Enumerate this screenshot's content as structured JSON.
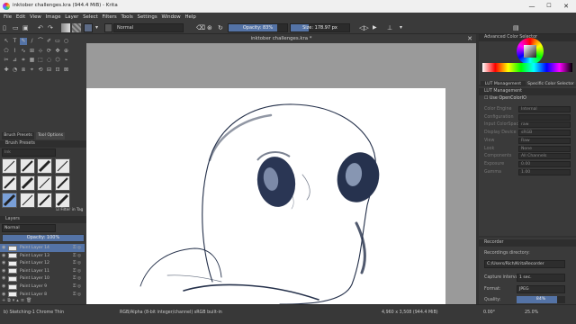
{
  "window": {
    "title": "inktober challenges.kra (944.4 MiB) - Krita",
    "minimize": "—",
    "maximize": "☐",
    "close": "✕"
  },
  "menu": [
    "File",
    "Edit",
    "View",
    "Image",
    "Layer",
    "Select",
    "Filters",
    "Tools",
    "Settings",
    "Window",
    "Help"
  ],
  "toolbar": {
    "blend_mode": "Normal",
    "opacity_label": "Opacity: 83%",
    "opacity_value": 0.83,
    "size_label": "Size: 178.97 px",
    "size_fill": 0.3
  },
  "document": {
    "tab_title": "inktober challenges.kra *"
  },
  "brush_panel": {
    "tab_presets": "Brush Presets",
    "tab_tool_options": "Tool Options",
    "header": "Brush Presets",
    "tag": "Ink",
    "filter_label": "Filter in Tag"
  },
  "layers_panel": {
    "header": "Layers",
    "blend_mode": "Normal",
    "opacity_label": "Opacity: 100%",
    "opacity_value": 1.0,
    "layers": [
      {
        "name": "Paint Layer 14",
        "selected": true
      },
      {
        "name": "Paint Layer 13",
        "selected": false
      },
      {
        "name": "Paint Layer 12",
        "selected": false
      },
      {
        "name": "Paint Layer 11",
        "selected": false
      },
      {
        "name": "Paint Layer 10",
        "selected": false
      },
      {
        "name": "Paint Layer 9",
        "selected": false
      },
      {
        "name": "Paint Layer 8",
        "selected": false
      }
    ]
  },
  "color_panel": {
    "header": "Advanced Color Selector",
    "tab_lut": "LUT Management",
    "tab_specific": "Specific Color Selector",
    "accent": "#5473a6"
  },
  "lut_panel": {
    "header": "LUT Management",
    "use_ocio": "Use OpenColorIO",
    "fields": [
      {
        "label": "Color Engine",
        "value": "Internal"
      },
      {
        "label": "Configuration",
        "value": ""
      },
      {
        "label": "Input ColorSpace",
        "value": "raw"
      },
      {
        "label": "Display Device",
        "value": "sRGB"
      },
      {
        "label": "View",
        "value": "Raw"
      },
      {
        "label": "Look",
        "value": "None"
      },
      {
        "label": "Components",
        "value": "All Channels"
      },
      {
        "label": "Exposure",
        "value": "0.00"
      },
      {
        "label": "Gamma",
        "value": "1.00"
      }
    ]
  },
  "recorder_panel": {
    "header": "Recorder",
    "dir_label": "Recordings directory:",
    "dir_value": "C:/Users/Rich/KritaRecorder",
    "interval_label": "Capture interval:",
    "interval_value": "1 sec.",
    "format_label": "Format:",
    "format_value": "JPEG",
    "quality_label": "Quality:",
    "quality_value": "84%",
    "quality_fraction": 0.84
  },
  "status": {
    "tool": "b) Sketching-1 Chrome Thin",
    "color": "RGB/Alpha (8-bit integer/channel)  sRGB built-in",
    "size": "4,960 x 3,508 (944.4 MiB)",
    "rotation": "0.00°",
    "zoom": "25.0%"
  }
}
